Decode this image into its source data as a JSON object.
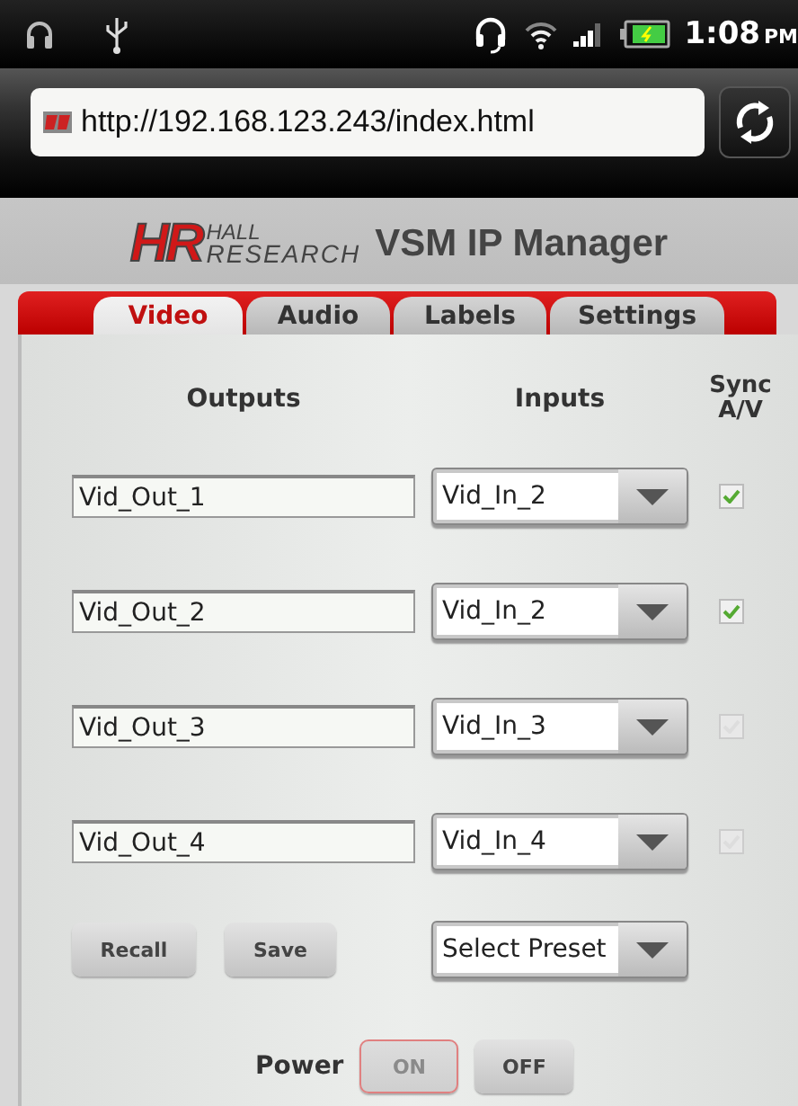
{
  "status_bar": {
    "time": "1:08",
    "period": "PM"
  },
  "browser": {
    "url": "http://192.168.123.243/index.html"
  },
  "header": {
    "logo_mark": "HR",
    "logo_top": "HALL",
    "logo_bottom": "RESEARCH",
    "title": "VSM IP Manager"
  },
  "tabs": [
    {
      "label": "Video",
      "selected": true
    },
    {
      "label": "Audio",
      "selected": false
    },
    {
      "label": "Labels",
      "selected": false
    },
    {
      "label": "Settings",
      "selected": false
    }
  ],
  "columns": {
    "outputs": "Outputs",
    "inputs": "Inputs",
    "sync": "Sync A/V"
  },
  "rows": [
    {
      "output": "Vid_Out_1",
      "input": "Vid_In_2",
      "sync": true
    },
    {
      "output": "Vid_Out_2",
      "input": "Vid_In_2",
      "sync": true
    },
    {
      "output": "Vid_Out_3",
      "input": "Vid_In_3",
      "sync": false
    },
    {
      "output": "Vid_Out_4",
      "input": "Vid_In_4",
      "sync": false
    }
  ],
  "preset": {
    "buttons": [
      "Recall",
      "Save"
    ],
    "select": "Select Preset"
  },
  "power": {
    "label": "Power",
    "buttons": [
      {
        "label": "ON",
        "selected": true
      },
      {
        "label": "OFF",
        "selected": false
      }
    ]
  }
}
